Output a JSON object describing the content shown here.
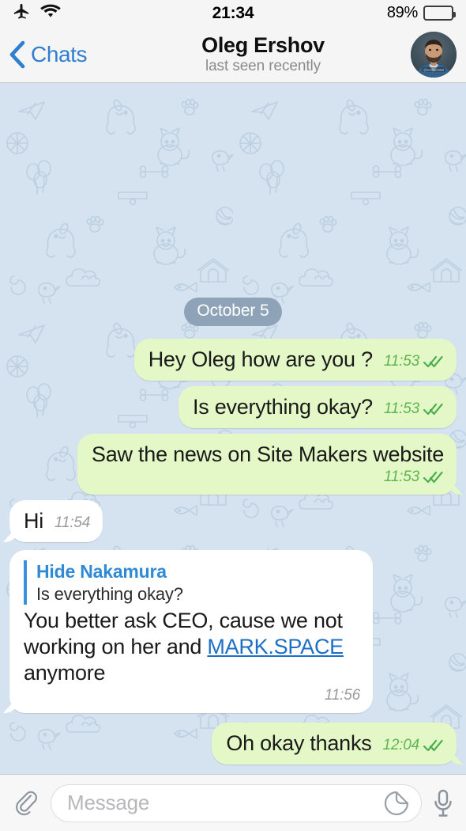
{
  "status_bar": {
    "airplane_icon": "airplane-mode-icon",
    "wifi_icon": "wifi-icon",
    "time": "21:34",
    "battery_percent": "89%",
    "battery_level": 89,
    "battery_color": "#fdd017"
  },
  "nav_bar": {
    "back_label": "Chats",
    "back_icon": "chevron-left-icon",
    "title": "Oleg Ershov",
    "subtitle": "last seen recently",
    "accent_color": "#2f7fd1",
    "avatar_alt": "contact-avatar"
  },
  "chat": {
    "background_color": "#d5e2ef",
    "date_separator": "October 5",
    "outgoing_bubble_color": "#e4f7c7",
    "incoming_bubble_color": "#ffffff",
    "messages": [
      {
        "id": "m1",
        "direction": "out",
        "text": "Hey Oleg how are you ?",
        "time": "11:53",
        "status": "read",
        "layout": "inline",
        "tail": false
      },
      {
        "id": "m2",
        "direction": "out",
        "text": "Is everything okay?",
        "time": "11:53",
        "status": "read",
        "layout": "inline",
        "tail": false
      },
      {
        "id": "m3",
        "direction": "out",
        "text": "Saw the news on Site Makers website",
        "time": "11:53",
        "status": "read",
        "layout": "stacked",
        "tail": true
      },
      {
        "id": "m4",
        "direction": "in",
        "text": "Hi",
        "time": "11:54",
        "status": "none",
        "layout": "inline",
        "tail": true
      },
      {
        "id": "m5",
        "direction": "in",
        "reply_quote": {
          "author": "Hide Nakamura",
          "text": "Is everything okay?"
        },
        "text_parts": [
          {
            "type": "text",
            "value": "You better ask CEO, cause we not working on her and "
          },
          {
            "type": "link",
            "value": "MARK.SPACE"
          },
          {
            "type": "text",
            "value": " anymore"
          }
        ],
        "time": "11:56",
        "status": "none",
        "layout": "stacked",
        "tail": true
      },
      {
        "id": "m6",
        "direction": "out",
        "text": "Oh okay thanks",
        "time": "12:04",
        "status": "read",
        "layout": "inline",
        "tail": true
      }
    ]
  },
  "input_bar": {
    "attach_icon": "paperclip-icon",
    "placeholder": "Message",
    "value": "",
    "sticker_icon": "sticker-icon",
    "mic_icon": "microphone-icon"
  }
}
